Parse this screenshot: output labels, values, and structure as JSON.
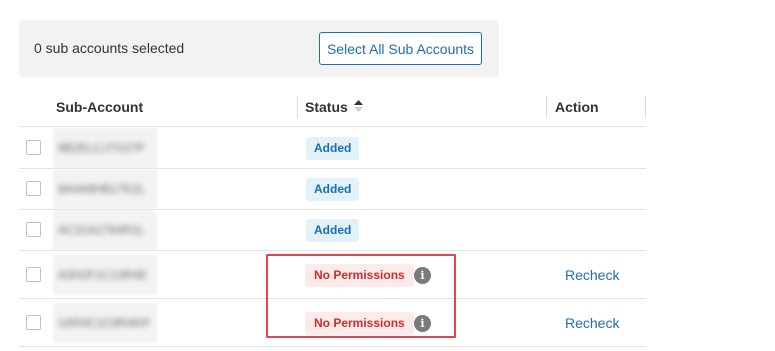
{
  "selection": {
    "count_text": "0 sub accounts selected",
    "select_all_label": "Select All Sub Accounts"
  },
  "table": {
    "headers": {
      "sub_account": "Sub-Account",
      "status": "Status",
      "action": "Action"
    },
    "sort_icon": "sort-arrows-icon",
    "rows": [
      {
        "account": "9B2ELCJ7X27P",
        "status": "Added",
        "action": ""
      },
      {
        "account": "8A4A9HB17K2L",
        "status": "Added",
        "action": ""
      },
      {
        "account": "AC31A2784R1L",
        "status": "Added",
        "action": ""
      },
      {
        "account": "A3H2F1C13R4E",
        "status": "No Permissions",
        "action": "Recheck"
      },
      {
        "account": "1AR4C1C9R4KP",
        "status": "No Permissions",
        "action": "Recheck"
      }
    ]
  },
  "info_icon_glyph": "i",
  "colors": {
    "accent": "#1f6db2",
    "added_bg": "#e3f1fb",
    "added_text": "#1a6fb0",
    "noperm_bg": "#fdebeb",
    "noperm_text": "#d42a2a",
    "highlight": "#e0484f"
  }
}
